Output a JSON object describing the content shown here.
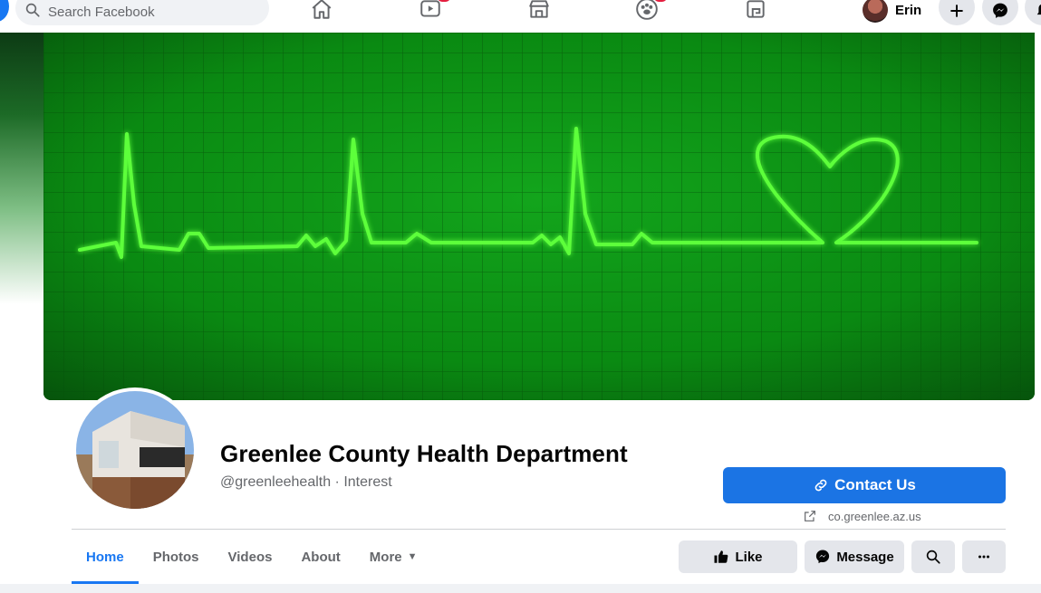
{
  "topbar": {
    "search_placeholder": "Search Facebook",
    "nav_icons": [
      "home-icon",
      "watch-icon",
      "marketplace-icon",
      "groups-icon",
      "gaming-icon"
    ],
    "user_name": "Erin",
    "buttons": [
      "create-plus-icon",
      "messenger-icon",
      "notifications-icon"
    ]
  },
  "page": {
    "name": "Greenlee County Health Department",
    "handle_line": "@greenleehealth · Interest",
    "cover_description_icon": "heartbeat-ecg-heart",
    "contact_button": "Contact Us",
    "website": "co.greenlee.az.us"
  },
  "tabs": [
    {
      "label": "Home",
      "active": true
    },
    {
      "label": "Photos",
      "active": false
    },
    {
      "label": "Videos",
      "active": false
    },
    {
      "label": "About",
      "active": false
    },
    {
      "label": "More",
      "active": false
    }
  ],
  "actions": {
    "like": "Like",
    "message": "Message"
  },
  "colors": {
    "brand_blue": "#1877f2",
    "button_blue": "#1b74e4",
    "cover_green": "#0a7d10",
    "ecg_line": "#5dff3a"
  }
}
